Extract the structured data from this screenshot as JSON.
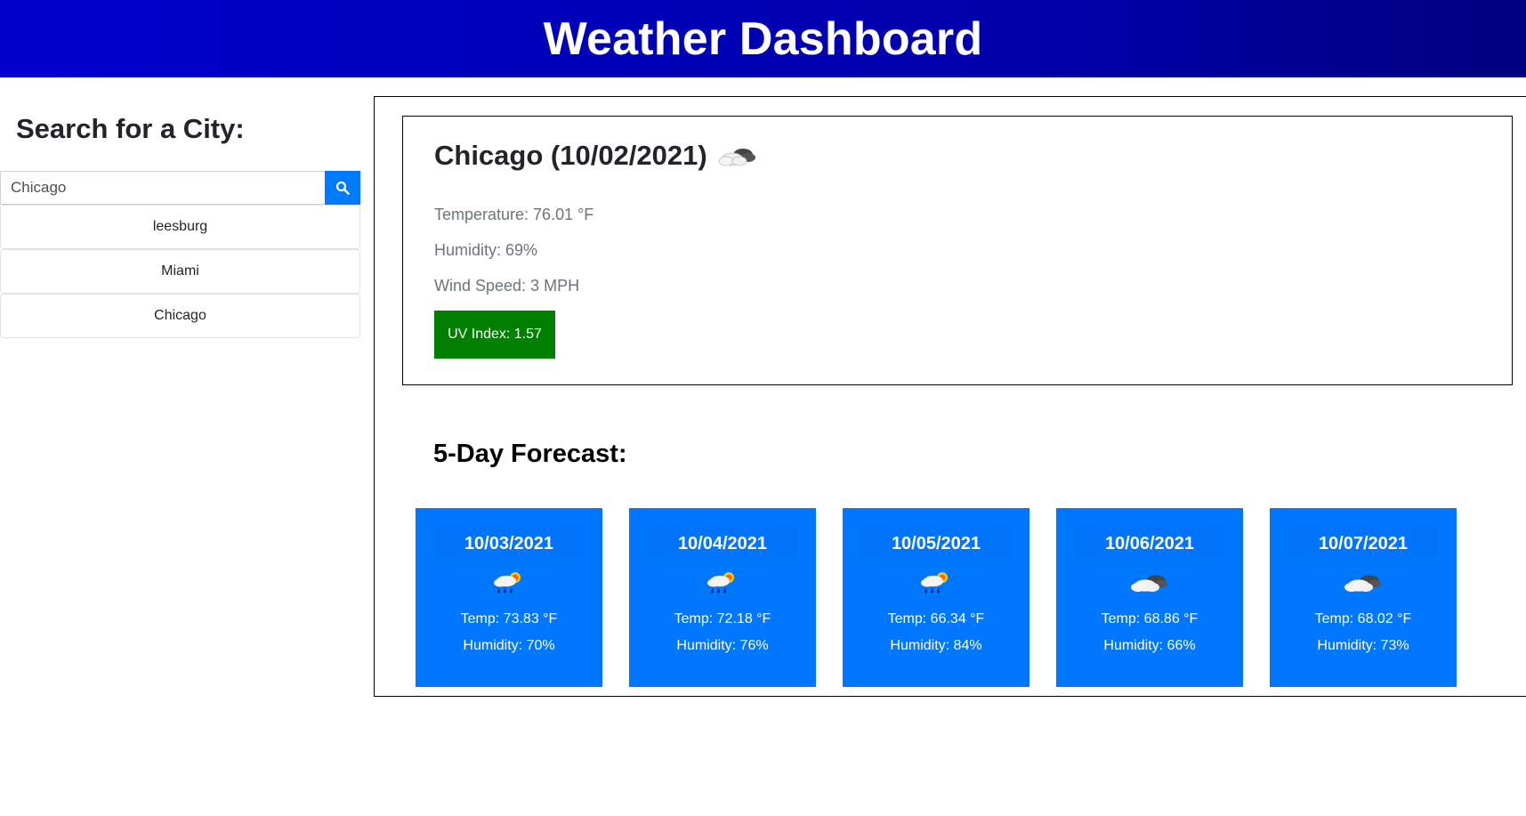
{
  "header": {
    "title": "Weather Dashboard"
  },
  "sidebar": {
    "heading": "Search for a City:",
    "search": {
      "value": "Chicago",
      "button_icon": "search-icon"
    },
    "history": [
      {
        "label": "leesburg"
      },
      {
        "label": "Miami"
      },
      {
        "label": "Chicago"
      }
    ]
  },
  "current": {
    "title": "Chicago (10/02/2021)",
    "icon": "partly-cloudy-icon",
    "temperature": "Temperature: 76.01 °F",
    "humidity": "Humidity: 69%",
    "wind": "Wind Speed: 3 MPH",
    "uv": "UV Index: 1.57",
    "uv_color": "#008000"
  },
  "forecast": {
    "heading": "5-Day Forecast:",
    "card_color": "#0077ff",
    "days": [
      {
        "date": "10/03/2021",
        "icon": "rain-sun-icon",
        "temp": "Temp: 73.83 °F",
        "humidity": "Humidity: 70%"
      },
      {
        "date": "10/04/2021",
        "icon": "rain-sun-icon",
        "temp": "Temp: 72.18 °F",
        "humidity": "Humidity: 76%"
      },
      {
        "date": "10/05/2021",
        "icon": "rain-sun-icon",
        "temp": "Temp: 66.34 °F",
        "humidity": "Humidity: 84%"
      },
      {
        "date": "10/06/2021",
        "icon": "cloudy-icon",
        "temp": "Temp: 68.86 °F",
        "humidity": "Humidity: 66%"
      },
      {
        "date": "10/07/2021",
        "icon": "cloudy-icon",
        "temp": "Temp: 68.02 °F",
        "humidity": "Humidity: 73%"
      }
    ]
  }
}
